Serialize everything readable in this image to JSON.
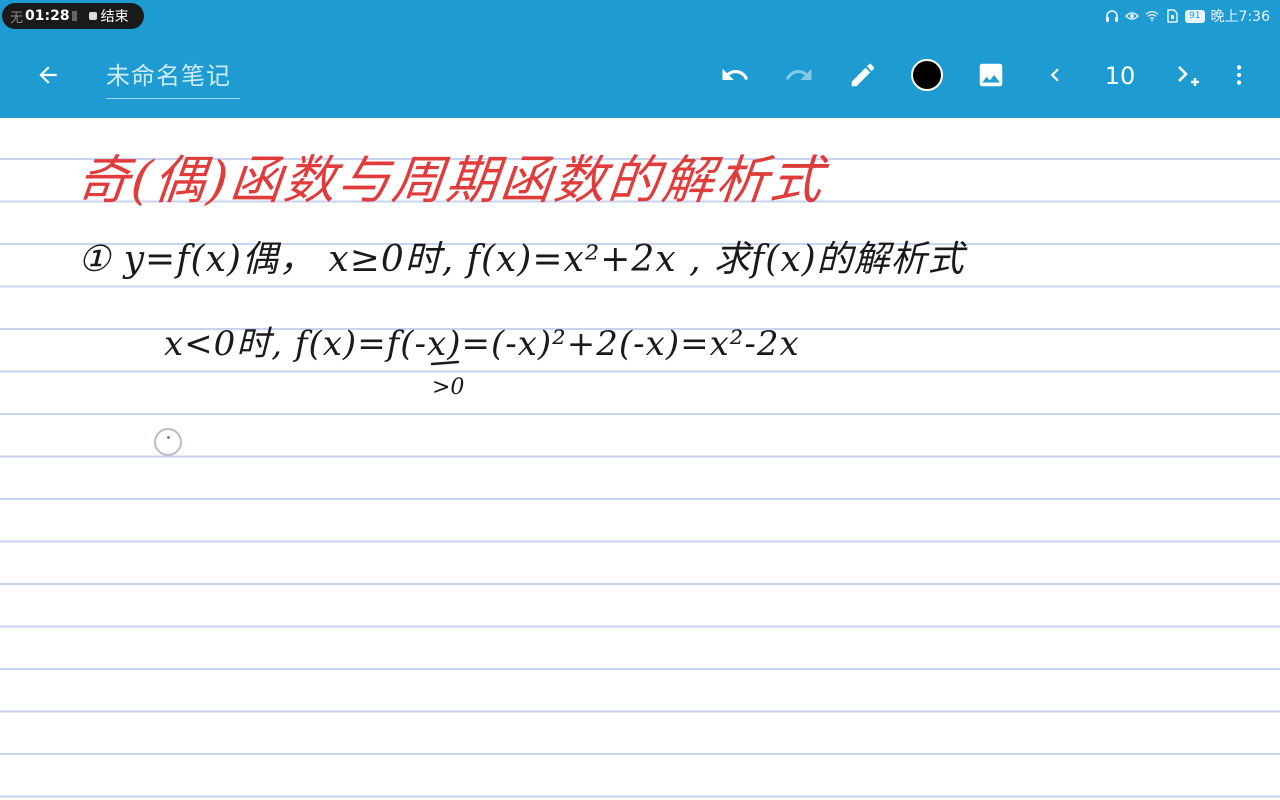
{
  "status_bar": {
    "carrier_prefix": "无",
    "record_time": "01:28",
    "end_label": "结束",
    "battery": "91",
    "clock": "晚上7:36"
  },
  "toolbar": {
    "title": "未命名笔记",
    "page_number": "10",
    "pen_color": "#000000",
    "icons": [
      "back-arrow-icon",
      "undo-icon",
      "redo-icon",
      "pen-icon",
      "color-swatch-icon",
      "image-icon",
      "chevron-left-icon",
      "next-add-icon",
      "more-vert-icon"
    ]
  },
  "note": {
    "heading": "奇(偶)函数与周期函数的解析式",
    "line1": "① y=f(x)偶， x≥0时, f(x)=x²+2x , 求f(x)的解析式",
    "line2": "x<0时, f(x)=f(-x)=(-x)²+2(-x)=x²-2x",
    "annotation": ">0",
    "ink_colors": {
      "heading": "#e03c3c",
      "body": "#1a1a1a"
    }
  }
}
